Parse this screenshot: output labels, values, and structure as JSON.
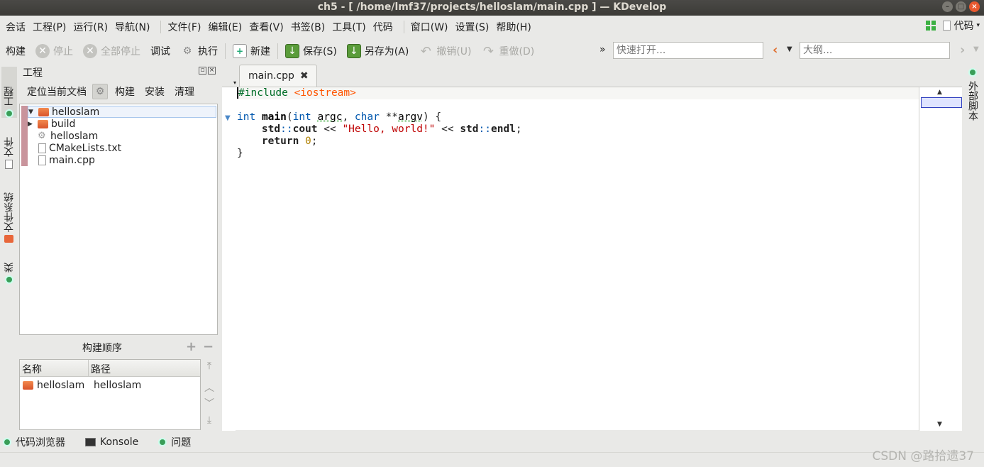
{
  "window": {
    "title": "ch5 - [ /home/lmf37/projects/helloslam/main.cpp ] — KDevelop"
  },
  "menubar": {
    "items": [
      "会话",
      "工程(P)",
      "运行(R)",
      "导航(N)",
      "文件(F)",
      "编辑(E)",
      "查看(V)",
      "书签(B)",
      "工具(T)",
      "代码",
      "窗口(W)",
      "设置(S)",
      "帮助(H)"
    ],
    "right_label": "代码"
  },
  "toolbar": {
    "build": "构建",
    "stop": "停止",
    "stop_all": "全部停止",
    "debug": "调试",
    "execute": "执行",
    "new": "新建",
    "save": "保存(S)",
    "save_as": "另存为(A)",
    "undo": "撤销(U)",
    "redo": "重做(D)",
    "more": "»",
    "quick_open_placeholder": "快速打开...",
    "outline_placeholder": "大纲..."
  },
  "left_dock": {
    "tabs": [
      "工程",
      "文件",
      "文件系统",
      "类"
    ]
  },
  "project_panel": {
    "title": "工程",
    "toolbar": [
      "定位当前文档",
      "构建",
      "安装",
      "清理"
    ],
    "tree": [
      {
        "label": "helloslam",
        "type": "project",
        "expanded": true
      },
      {
        "label": "build",
        "type": "folder",
        "expanded": false
      },
      {
        "label": "helloslam",
        "type": "executable"
      },
      {
        "label": "CMakeLists.txt",
        "type": "file"
      },
      {
        "label": "main.cpp",
        "type": "file"
      }
    ]
  },
  "build_order": {
    "title": "构建顺序",
    "columns": [
      "名称",
      "路径"
    ],
    "rows": [
      {
        "name": "helloslam",
        "path": "helloslam"
      }
    ]
  },
  "editor": {
    "tab_label": "main.cpp",
    "code_lines": [
      "#include <iostream>",
      "",
      "int main(int argc, char **argv) {",
      "    std::cout << \"Hello, world!\" << std::endl;",
      "    return 0;",
      "}"
    ]
  },
  "right_dock": {
    "tab": "外部脚本"
  },
  "statusbar": {
    "items": [
      "代码浏览器",
      "Konsole",
      "问题"
    ]
  },
  "watermark": "CSDN @路拾遗37"
}
